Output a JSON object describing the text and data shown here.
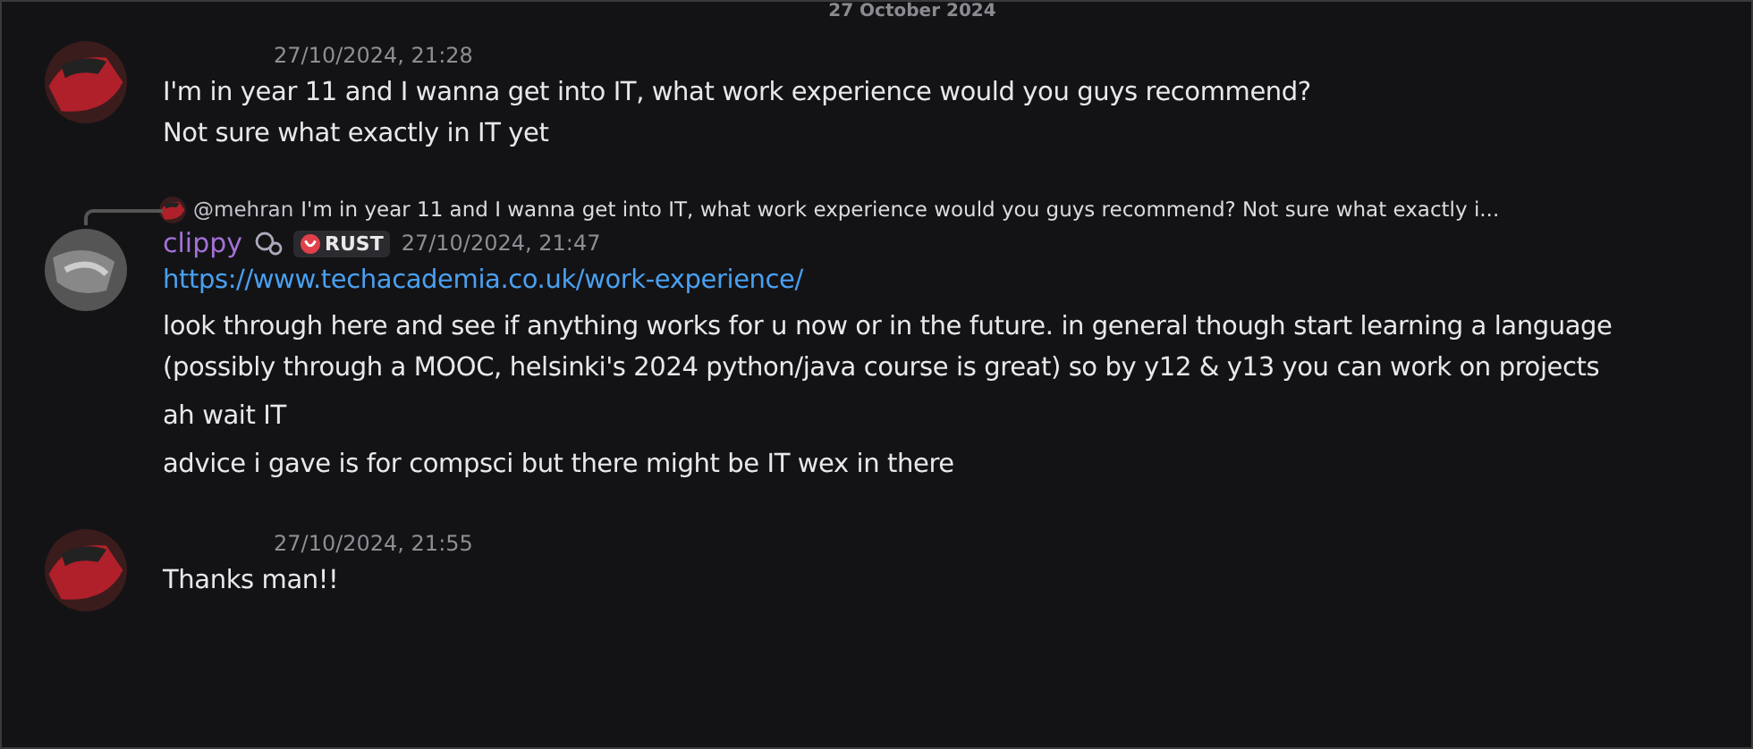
{
  "date_divider": "27 October 2024",
  "messages": [
    {
      "timestamp": "27/10/2024, 21:28",
      "content": [
        {
          "kind": "text",
          "text": "I'm in year 11 and I wanna get into IT, what work experience would you guys recommend?\nNot sure what exactly in IT yet"
        }
      ]
    },
    {
      "reply": {
        "mention": "@mehran",
        "text": "I'm in year 11 and I wanna get into IT, what work experience would you guys recommend?  Not sure what exactly i..."
      },
      "username": "clippy",
      "tag": "RUST",
      "timestamp": "27/10/2024, 21:47",
      "content": [
        {
          "kind": "link",
          "text": "https://www.techacademia.co.uk/work-experience/"
        },
        {
          "kind": "text",
          "text": "look through here and see if anything works for u now or in the future. in general though start learning a language (possibly through a MOOC, helsinki's 2024 python/java course is great) so by y12 & y13 you can work on projects"
        },
        {
          "kind": "text",
          "text": "ah wait IT"
        },
        {
          "kind": "text",
          "text": "advice i gave is for compsci but there might be IT wex in there"
        }
      ]
    },
    {
      "timestamp": "27/10/2024, 21:55",
      "content": [
        {
          "kind": "text",
          "text": "Thanks man!!"
        }
      ]
    }
  ]
}
